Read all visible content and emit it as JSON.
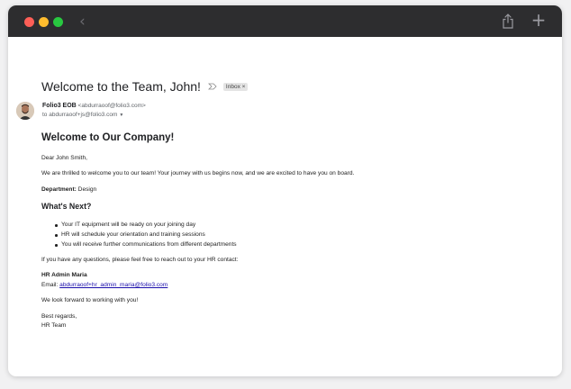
{
  "window": {
    "colors": {
      "titlebar": "#2d2d2f",
      "close": "#fe5f57",
      "minimize": "#febc2e",
      "zoom": "#28c840"
    },
    "back_glyph": "‹",
    "new_glyph": "+"
  },
  "email": {
    "subject": "Welcome to the Team, John!",
    "label": "Inbox ×",
    "sender_name": "Folio3 EOB",
    "sender_email": "<abdurraoof@folio3.com>",
    "to_line": "to abdurraoof+js@folio3.com",
    "heading": "Welcome to Our Company!",
    "greeting": "Dear John Smith,",
    "intro": "We are thrilled to welcome you to our team! Your journey with us begins now, and we are excited to have you on board.",
    "department_label": "Department:",
    "department_value": " Design",
    "next_heading": "What's Next?",
    "next_items": [
      "Your IT equipment will be ready on your joining day",
      "HR will schedule your orientation and training sessions",
      "You will receive further communications from different departments"
    ],
    "questions": "If you have any questions, please feel free to reach out to your HR contact:",
    "hr_name": "HR Admin Maria",
    "hr_email_label": "Email: ",
    "hr_email": "abdurraoof+hr_admin_maria@folio3.com",
    "closing_line": "We look forward to working with you!",
    "sign_off": "Best regards,",
    "signature": "HR Team"
  }
}
